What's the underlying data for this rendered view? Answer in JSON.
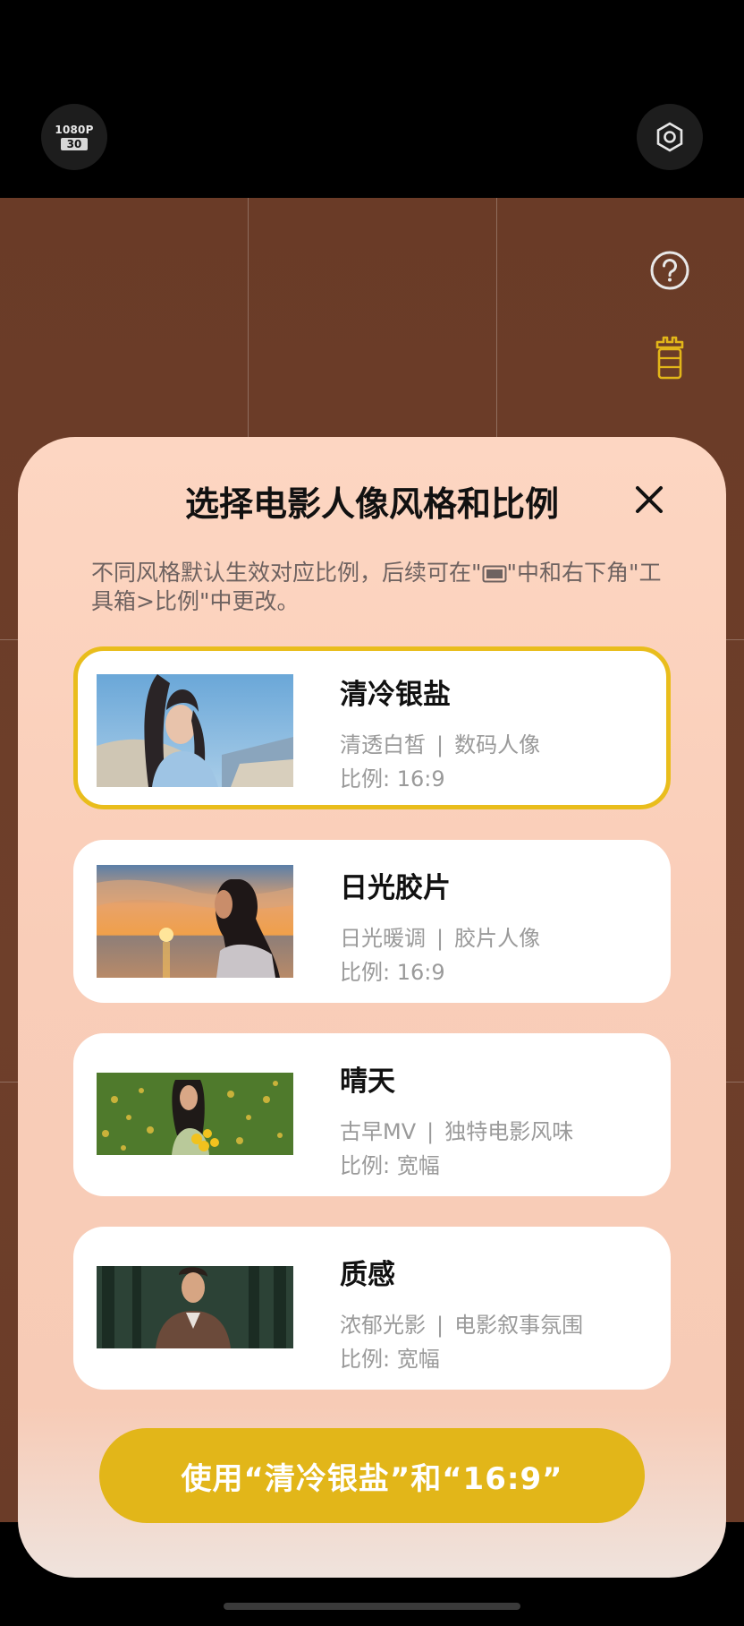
{
  "camera": {
    "resolution": "1080P",
    "fps": "30",
    "icons": [
      "settings-icon",
      "help-icon",
      "toolbox-icon"
    ]
  },
  "sheet": {
    "title": "选择电影人像风格和比例",
    "desc_part1": "不同风格默认生效对应比例，后续可在\"",
    "desc_part2": "\"中和右下角\"工具箱>比例\"中更改。",
    "desc_icon": "aspect-ratio-icon",
    "styles": [
      {
        "title": "清冷银盐",
        "tag1": "清透白皙",
        "tag2": "数码人像",
        "ratio": "比例: 16:9",
        "selected": true
      },
      {
        "title": "日光胶片",
        "tag1": "日光暖调",
        "tag2": "胶片人像",
        "ratio": "比例: 16:9",
        "selected": false
      },
      {
        "title": "晴天",
        "tag1": "古早MV",
        "tag2": "独特电影风味",
        "ratio": "比例: 宽幅",
        "selected": false
      },
      {
        "title": "质感",
        "tag1": "浓郁光影",
        "tag2": "电影叙事氛围",
        "ratio": "比例: 宽幅",
        "selected": false
      }
    ],
    "separator": "|",
    "confirm_button": "使用“清冷银盐”和“16:9”"
  },
  "colors": {
    "accent": "#e2b619",
    "selected_border": "#e9bd1c",
    "viewfinder": "#6b3c28"
  }
}
